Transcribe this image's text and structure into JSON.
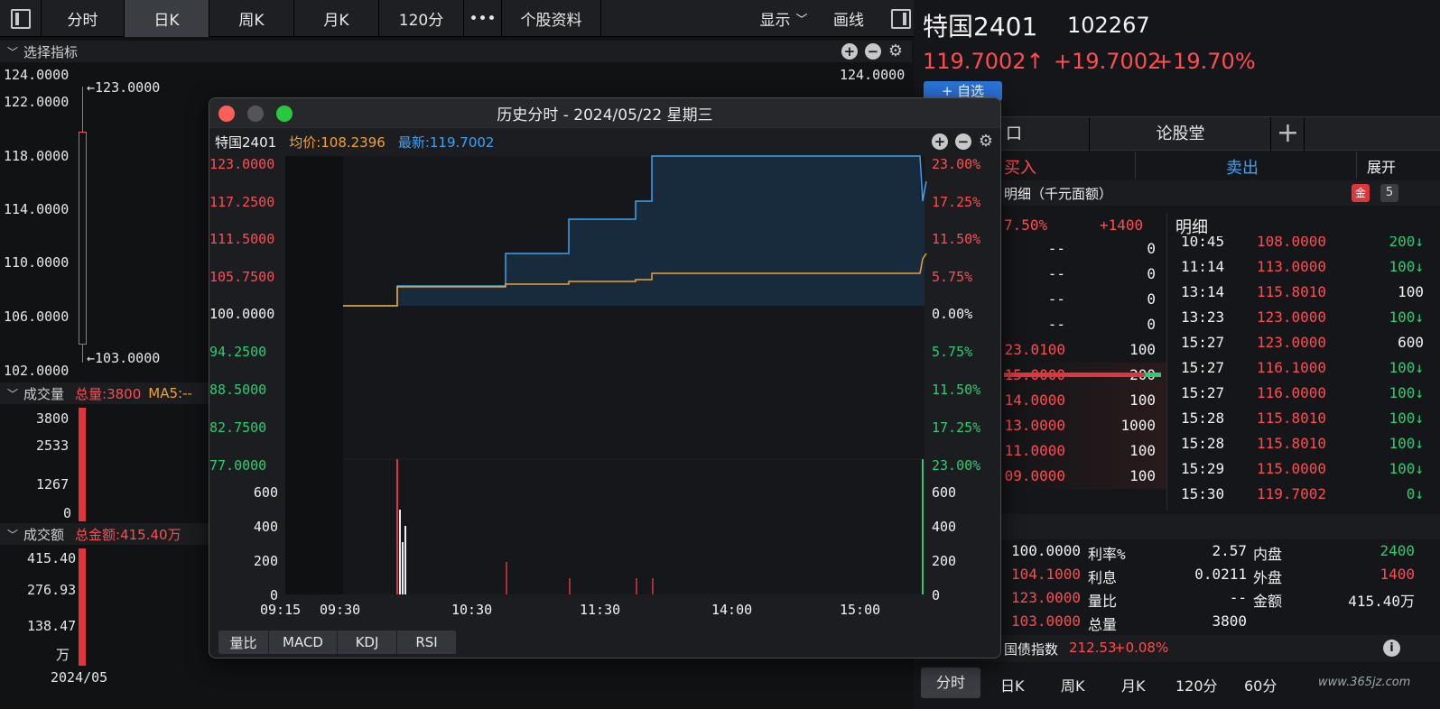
{
  "toolbar": {
    "tabs": [
      "分时",
      "日K",
      "周K",
      "月K",
      "120分",
      "•••",
      "个股资料"
    ],
    "active": "日K",
    "display": "显示",
    "draw": "画线"
  },
  "left": {
    "indicator_title": "选择指标",
    "price_labels": [
      "124.0000",
      "122.0000",
      "118.0000",
      "114.0000",
      "110.0000",
      "106.0000",
      "102.0000"
    ],
    "right_price_label": "124.0000",
    "high_label": "←123.0000",
    "low_label": "←103.0000",
    "volume": {
      "title": "成交量",
      "total": "总量:3800",
      "ma": "MA5:--",
      "labels": [
        "3800",
        "2533",
        "1267",
        "0"
      ]
    },
    "amount": {
      "title": "成交额",
      "total": "总金额:415.40万",
      "labels": [
        "415.40",
        "276.93",
        "138.47",
        "万"
      ]
    },
    "date": "2024/05"
  },
  "popup": {
    "title": "历史分时 - 2024/05/22 星期三",
    "stock": "特国2401",
    "avg": "均价:108.2396",
    "latest": "最新:119.7002",
    "left_axis": [
      "123.0000",
      "117.2500",
      "111.5000",
      "105.7500",
      "100.0000",
      "94.2500",
      "88.5000",
      "82.7500",
      "77.0000"
    ],
    "right_axis": [
      "23.00%",
      "17.25%",
      "11.50%",
      "5.75%",
      "0.00%",
      "5.75%",
      "11.50%",
      "17.25%",
      "23.00%"
    ],
    "vol_axis": [
      "600",
      "400",
      "200",
      "0"
    ],
    "times": [
      "09:15",
      "09:30",
      "10:30",
      "11:30",
      "14:00",
      "15:00"
    ],
    "tabs": [
      "量比",
      "MACD",
      "KDJ",
      "RSI"
    ],
    "colors": {
      "price": "#3fa2f0",
      "avg": "#f0a330"
    }
  },
  "right": {
    "name": "特国2401",
    "code": "102267",
    "price": "119.7002↑",
    "change": "+19.7002",
    "pct": "+19.70%",
    "add_button": "+ 自选",
    "tabs": [
      "口",
      "论股堂",
      "+"
    ],
    "trade": {
      "buy": "买入",
      "sell": "卖出",
      "expand": "展开"
    },
    "detail_title": "明细（千元面额）",
    "badge": "5",
    "order_hdr": {
      "pct": "7.50%",
      "val": "+1400"
    },
    "orders": [
      {
        "price": "--",
        "vol": "0"
      },
      {
        "price": "--",
        "vol": "0"
      },
      {
        "price": "--",
        "vol": "0"
      },
      {
        "price": "--",
        "vol": "0"
      },
      {
        "price": "23.0100",
        "vol": "100"
      },
      {
        "price": "15.0000",
        "vol": "200"
      },
      {
        "price": "14.0000",
        "vol": "100"
      },
      {
        "price": "13.0000",
        "vol": "1000"
      },
      {
        "price": "11.0000",
        "vol": "100"
      },
      {
        "price": "09.0000",
        "vol": "100"
      }
    ],
    "trades_title": "明细",
    "trades": [
      {
        "time": "10:45",
        "price": "108.0000",
        "vol": "200↓",
        "c": "g"
      },
      {
        "time": "11:14",
        "price": "113.0000",
        "vol": "100↓",
        "c": "g"
      },
      {
        "time": "13:14",
        "price": "115.8010",
        "vol": "100",
        "c": "w"
      },
      {
        "time": "13:23",
        "price": "123.0000",
        "vol": "100↓",
        "c": "g"
      },
      {
        "time": "15:27",
        "price": "123.0000",
        "vol": "600",
        "c": "w"
      },
      {
        "time": "15:27",
        "price": "116.1000",
        "vol": "100↓",
        "c": "g"
      },
      {
        "time": "15:27",
        "price": "116.0000",
        "vol": "100↓",
        "c": "g"
      },
      {
        "time": "15:28",
        "price": "115.8010",
        "vol": "100↓",
        "c": "g"
      },
      {
        "time": "15:28",
        "price": "115.8010",
        "vol": "100↓",
        "c": "g"
      },
      {
        "time": "15:29",
        "price": "115.0000",
        "vol": "100↓",
        "c": "g"
      },
      {
        "time": "15:30",
        "price": "119.7002",
        "vol": "0↓",
        "c": "g"
      }
    ],
    "stats": [
      [
        "100.0000",
        "利率%",
        "2.57",
        "内盘",
        "2400"
      ],
      [
        "104.1000",
        "利息",
        "0.0211",
        "外盘",
        "1400"
      ],
      [
        "123.0000",
        "量比",
        "--",
        "金额",
        "415.40万"
      ],
      [
        "103.0000",
        "总量",
        "3800",
        "",
        ""
      ]
    ],
    "index": {
      "name": "国债指数",
      "value": "212.53",
      "chg": "+0.08%"
    },
    "bottom_tabs": [
      "分时",
      "日K",
      "周K",
      "月K",
      "120分",
      "60分"
    ],
    "watermark": "www.365jz.com"
  }
}
